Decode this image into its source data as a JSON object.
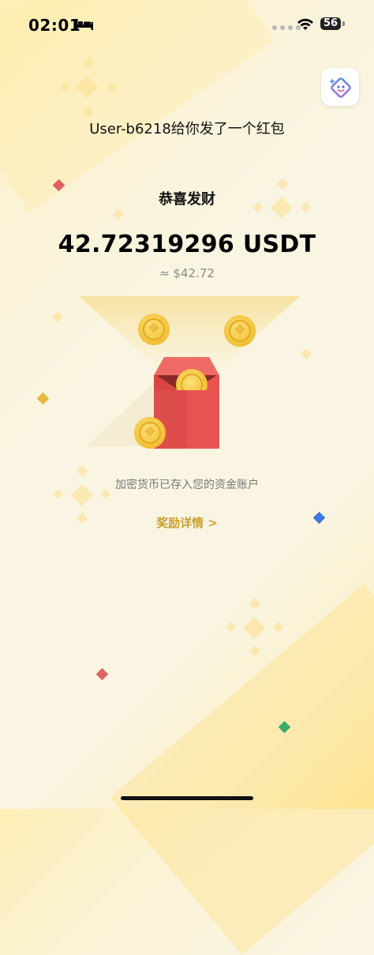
{
  "status_bar": {
    "time": "02:01",
    "battery_level": "56",
    "icons": [
      "bed-icon",
      "signal-dots-icon",
      "wifi-icon",
      "battery-icon"
    ]
  },
  "header": {
    "app_icon": "sparkle-face-icon"
  },
  "red_packet": {
    "sender_line": "User-b6218给你发了一个红包",
    "greeting": "恭喜发财",
    "amount": "42.72319296 USDT",
    "fiat_value": "≈ $42.72",
    "note": "加密货币已存入您的资金账户",
    "reward_link": "奖励详情 >"
  },
  "colors": {
    "envelope_red": "#e85452",
    "coin_gold": "#f2c53d",
    "link_gold": "#c9a030",
    "deco_red": "#e06060",
    "deco_blue": "#3d78e0",
    "deco_green": "#3aaa6a",
    "deco_yellow": "#e8b840"
  }
}
